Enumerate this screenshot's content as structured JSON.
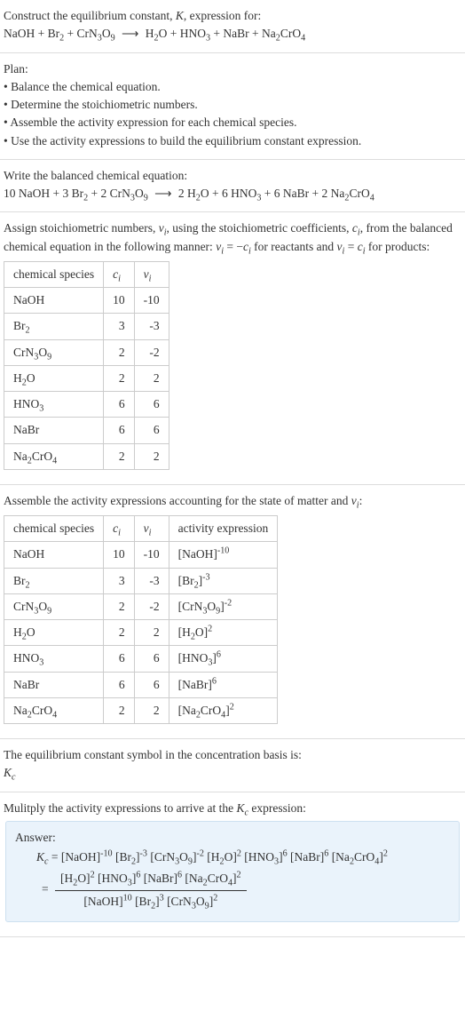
{
  "s1": {
    "title": "Construct the equilibrium constant, K, expression for:",
    "eq_lhs": "NaOH + Br",
    "eq_rhs": "O + HNO"
  },
  "s2": {
    "title": "Plan:",
    "b1": "• Balance the chemical equation.",
    "b2": "• Determine the stoichiometric numbers.",
    "b3": "• Assemble the activity expression for each chemical species.",
    "b4": "• Use the activity expressions to build the equilibrium constant expression."
  },
  "s3": {
    "title": "Write the balanced chemical equation:"
  },
  "s4": {
    "intro1": "Assign stoichiometric numbers, ",
    "intro2": ", using the stoichiometric coefficients, ",
    "intro3": ", from the balanced chemical equation in the following manner: ",
    "intro4": " for reactants and ",
    "intro5": " for products:",
    "h1": "chemical species",
    "rows": [
      {
        "sp": "NaOH",
        "c": "10",
        "v": "-10"
      },
      {
        "sp": "Br",
        "sub": "2",
        "c": "3",
        "v": "-3"
      },
      {
        "sp": "CrN",
        "sub": "3",
        "sub2": "9",
        "mid": "O",
        "c": "2",
        "v": "-2"
      },
      {
        "sp": "H",
        "sub": "2",
        "mid": "O",
        "c": "2",
        "v": "2"
      },
      {
        "sp": "HNO",
        "sub": "3",
        "c": "6",
        "v": "6"
      },
      {
        "sp": "NaBr",
        "c": "6",
        "v": "6"
      },
      {
        "sp": "Na",
        "sub": "2",
        "mid": "CrO",
        "sub2": "4",
        "c": "2",
        "v": "2"
      }
    ]
  },
  "s5": {
    "title": "Assemble the activity expressions accounting for the state of matter and ",
    "h1": "chemical species",
    "h4": "activity expression"
  },
  "s6": {
    "l1": "The equilibrium constant symbol in the concentration basis is:"
  },
  "s7": {
    "title": "Mulitply the activity expressions to arrive at the ",
    "title2": " expression:"
  },
  "ans": {
    "label": "Answer:"
  },
  "chart_data": {
    "type": "table",
    "title": "Stoichiometric numbers and activity expressions",
    "columns": [
      "chemical species",
      "c_i",
      "ν_i",
      "activity expression"
    ],
    "rows": [
      [
        "NaOH",
        10,
        -10,
        "[NaOH]^-10"
      ],
      [
        "Br2",
        3,
        -3,
        "[Br2]^-3"
      ],
      [
        "CrN3O9",
        2,
        -2,
        "[CrN3O9]^-2"
      ],
      [
        "H2O",
        2,
        2,
        "[H2O]^2"
      ],
      [
        "HNO3",
        6,
        6,
        "[HNO3]^6"
      ],
      [
        "NaBr",
        6,
        6,
        "[NaBr]^6"
      ],
      [
        "Na2CrO4",
        2,
        2,
        "[Na2CrO4]^2"
      ]
    ],
    "balanced_equation": "10 NaOH + 3 Br2 + 2 CrN3O9 → 2 H2O + 6 HNO3 + 6 NaBr + 2 Na2CrO4",
    "Kc_expression": "([H2O]^2 [HNO3]^6 [NaBr]^6 [Na2CrO4]^2) / ([NaOH]^10 [Br2]^3 [CrN3O9]^2)"
  }
}
